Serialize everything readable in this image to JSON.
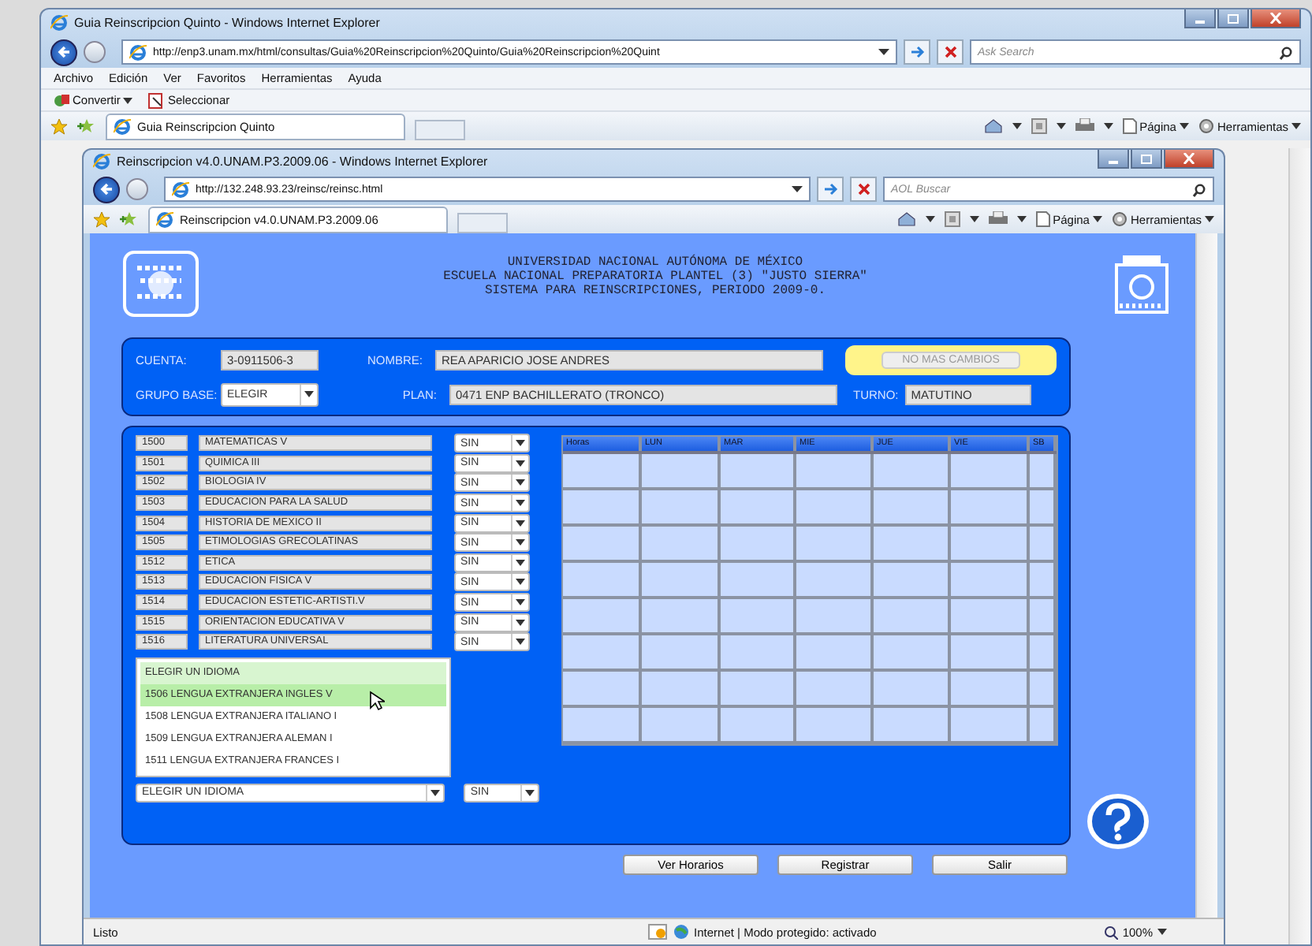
{
  "outer_window": {
    "title": "Guia Reinscripcion Quinto - Windows Internet Explorer",
    "address": "http://enp3.unam.mx/html/consultas/Guia%20Reinscripcion%20Quinto/Guia%20Reinscripcion%20Quint",
    "search_placeholder": "Ask Search",
    "menu": [
      "Archivo",
      "Edición",
      "Ver",
      "Favoritos",
      "Herramientas",
      "Ayuda"
    ],
    "toolbar": [
      "Convertir",
      "Seleccionar"
    ],
    "tab": "Guia Reinscripcion Quinto",
    "commands": [
      "Página",
      "Herramientas"
    ]
  },
  "inner_window": {
    "title": "Reinscripcion v4.0.UNAM.P3.2009.06 - Windows Internet Explorer",
    "address": "http://132.248.93.23/reinsc/reinsc.html",
    "search_placeholder": "AOL Buscar",
    "tab": "Reinscripcion v4.0.UNAM.P3.2009.06",
    "commands": [
      "Página",
      "Herramientas"
    ]
  },
  "page": {
    "header": [
      "UNIVERSIDAD NACIONAL AUTÓNOMA DE MÉXICO",
      "ESCUELA NACIONAL PREPARATORIA PLANTEL (3) \"JUSTO SIERRA\"",
      "SISTEMA PARA REINSCRIPCIONES, PERIODO 2009-0."
    ],
    "account": {
      "cuenta_label": "CUENTA:",
      "cuenta": "3-0911506-3",
      "nombre_label": "NOMBRE:",
      "nombre": "REA APARICIO JOSE ANDRES",
      "grupo_label": "GRUPO BASE:",
      "grupo": "ELEGIR",
      "plan_label": "PLAN:",
      "plan": "0471 ENP BACHILLERATO (TRONCO)",
      "turno_label": "TURNO:",
      "turno": "MATUTINO",
      "status_button": {
        "label": "NO MAS CAMBIOS",
        "disabled": true
      }
    },
    "subjects": [
      {
        "code": "1500",
        "name": "MATEMATICAS V",
        "option": "SIN"
      },
      {
        "code": "1501",
        "name": "QUIMICA III",
        "option": "SIN"
      },
      {
        "code": "1502",
        "name": "BIOLOGIA IV",
        "option": "SIN"
      },
      {
        "code": "1503",
        "name": "EDUCACION PARA LA SALUD",
        "option": "SIN"
      },
      {
        "code": "1504",
        "name": "HISTORIA DE MEXICO II",
        "option": "SIN"
      },
      {
        "code": "1505",
        "name": "ETIMOLOGIAS GRECOLATINAS",
        "option": "SIN"
      },
      {
        "code": "1512",
        "name": "ETICA",
        "option": "SIN"
      },
      {
        "code": "1513",
        "name": "EDUCACION FISICA V",
        "option": "SIN"
      },
      {
        "code": "1514",
        "name": "EDUCACION ESTETIC-ARTISTI.V",
        "option": "SIN"
      },
      {
        "code": "1515",
        "name": "ORIENTACION EDUCATIVA V",
        "option": "SIN"
      },
      {
        "code": "1516",
        "name": "LITERATURA UNIVERSAL",
        "option": "SIN"
      }
    ],
    "language_list": [
      {
        "label": "ELEGIR UN IDIOMA",
        "selected": true,
        "hovered": false
      },
      {
        "label": "1506 LENGUA EXTRANJERA INGLES V",
        "selected": false,
        "hovered": true
      },
      {
        "label": "1508 LENGUA EXTRANJERA ITALIANO I",
        "selected": false,
        "hovered": false
      },
      {
        "label": "1509 LENGUA EXTRANJERA ALEMAN I",
        "selected": false,
        "hovered": false
      },
      {
        "label": "1511 LENGUA EXTRANJERA FRANCES I",
        "selected": false,
        "hovered": false
      }
    ],
    "language_select": {
      "value": "ELEGIR UN IDIOMA",
      "option": "SIN"
    },
    "schedule": {
      "columns": [
        "Horas",
        "LUN",
        "MAR",
        "MIE",
        "JUE",
        "VIE",
        "SB"
      ]
    },
    "buttons": [
      "Ver Horarios",
      "Registrar",
      "Salir"
    ]
  },
  "status_bar": {
    "text": "Listo",
    "zone": "Internet | Modo protegido: activado",
    "zoom": "100%"
  }
}
